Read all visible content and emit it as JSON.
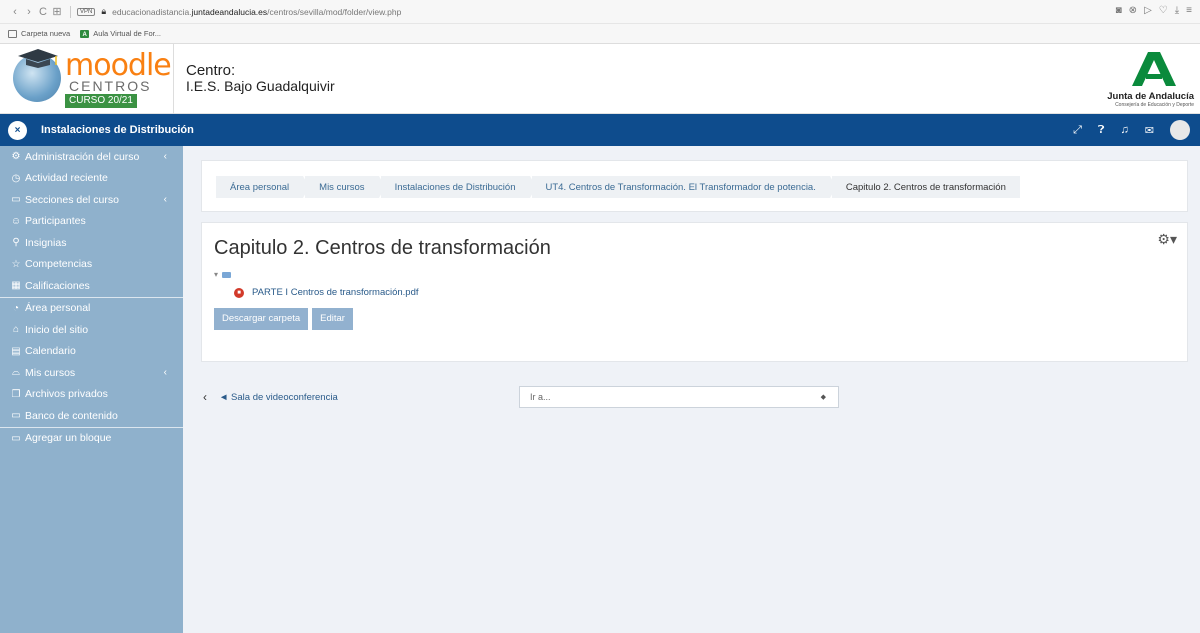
{
  "browser": {
    "url_prefix": "educacionadistancia.",
    "url_domain": "juntadeandalucia.es",
    "url_path": "/centros/sevilla/mod/folder/view.php",
    "vpn_label": "VPN",
    "bookmarks": [
      "Carpeta nueva",
      "Aula Virtual de For..."
    ]
  },
  "header": {
    "logo_moodle": "moodle",
    "logo_centros": "CENTROS",
    "logo_curso": "CURSO 20/21",
    "centro_label": "Centro:",
    "centro_name": "I.E.S. Bajo Guadalquivir",
    "junta_name": "Junta de Andalucía",
    "junta_sub": "Consejería de Educación y Deporte"
  },
  "navbar": {
    "course_title": "Instalaciones de Distribución",
    "close_glyph": "×"
  },
  "sidebar": {
    "group1": [
      {
        "label": "Administración del curso",
        "icon": "gears-icon",
        "chevron": true
      },
      {
        "label": "Actividad reciente",
        "icon": "clock-icon",
        "chevron": false
      },
      {
        "label": "Secciones del curso",
        "icon": "folder-icon",
        "chevron": true
      },
      {
        "label": "Participantes",
        "icon": "users-icon",
        "chevron": false
      },
      {
        "label": "Insignias",
        "icon": "badge-icon",
        "chevron": false
      },
      {
        "label": "Competencias",
        "icon": "star-icon",
        "chevron": false
      },
      {
        "label": "Calificaciones",
        "icon": "table-icon",
        "chevron": false
      }
    ],
    "group2": [
      {
        "label": "Área personal",
        "icon": "dashboard-icon",
        "chevron": false
      },
      {
        "label": "Inicio del sitio",
        "icon": "home-icon",
        "chevron": false
      },
      {
        "label": "Calendario",
        "icon": "calendar-icon",
        "chevron": false
      },
      {
        "label": "Mis cursos",
        "icon": "graduation-cap-icon",
        "chevron": true
      },
      {
        "label": "Archivos privados",
        "icon": "files-icon",
        "chevron": false
      },
      {
        "label": "Banco de contenido",
        "icon": "folder-icon",
        "chevron": false
      }
    ],
    "group3": [
      {
        "label": "Agregar un bloque",
        "icon": "folder-icon",
        "chevron": false
      }
    ]
  },
  "breadcrumb": [
    "Área personal",
    "Mis cursos",
    "Instalaciones de Distribución",
    "UT4. Centros de Transformación. El Transformador de potencia.",
    "Capitulo 2. Centros de transformación"
  ],
  "main": {
    "title": "Capitulo 2. Centros de transformación",
    "file_name": "PARTE I Centros de transformación.pdf",
    "download_button": "Descargar carpeta",
    "edit_button": "Editar"
  },
  "bottom_nav": {
    "prev_link": "◄ Sala de videoconferencia",
    "jump_placeholder": "Ir a..."
  }
}
